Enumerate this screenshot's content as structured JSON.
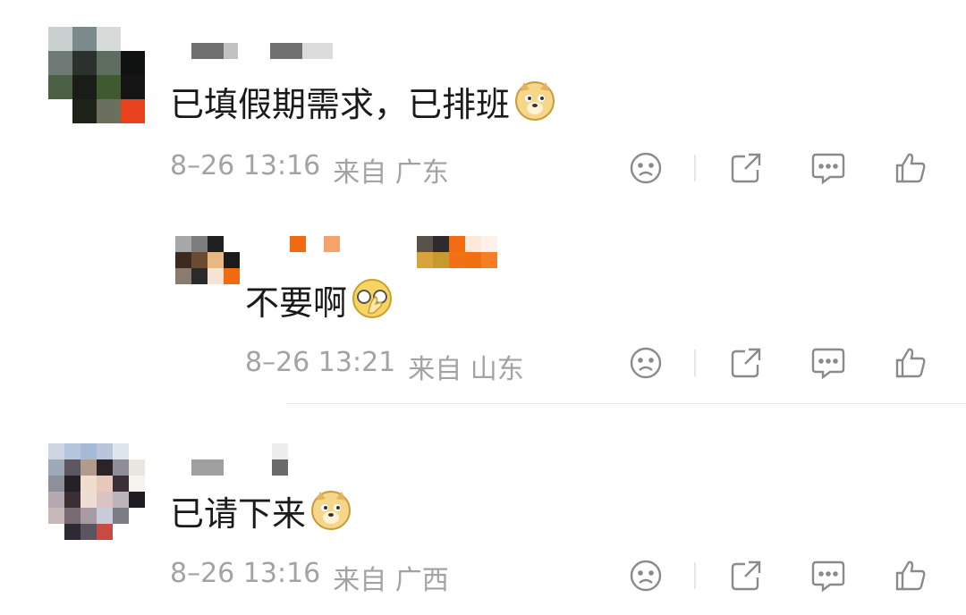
{
  "comments": [
    {
      "text": "已填假期需求，已排班",
      "emoji": "doge-emoji",
      "date": "8–26 13:16",
      "from": "来自 广东"
    },
    {
      "text": "不要啊",
      "emoji": "facepalm-emoji",
      "date": "8–26 13:21",
      "from": "来自 山东"
    },
    {
      "text": "已请下来",
      "emoji": "doge-emoji",
      "date": "8–26 13:16",
      "from": "来自 广西"
    }
  ],
  "actions": [
    "dislike-icon",
    "share-icon",
    "comment-icon",
    "like-icon"
  ],
  "colors": {
    "text": "#1a1a1a",
    "meta": "#a3a3a3",
    "icon": "#8a8a8a",
    "accent_orange": "#f07a1a"
  }
}
